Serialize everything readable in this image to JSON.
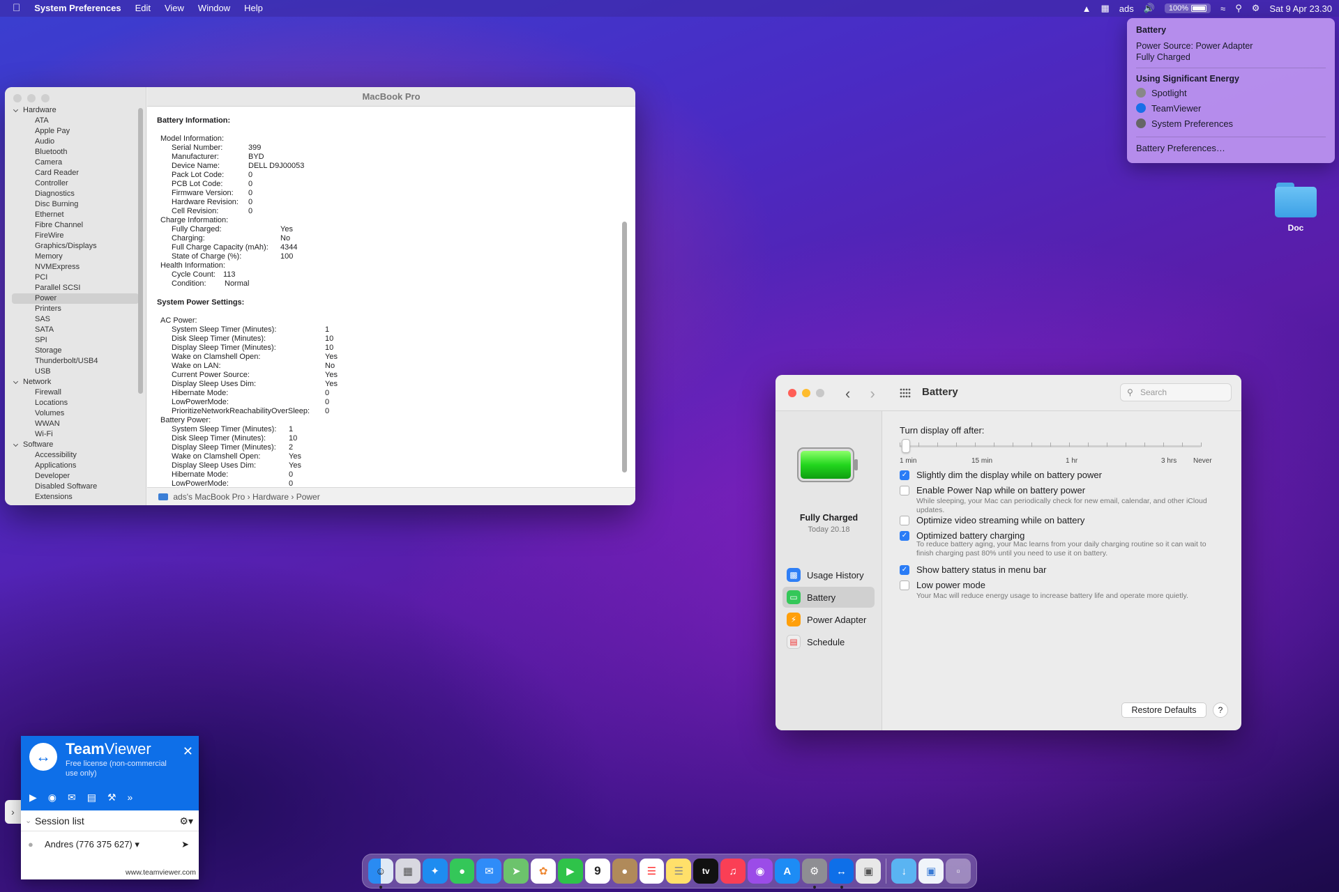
{
  "menubar": {
    "apple": "",
    "app": "System Preferences",
    "items": [
      "Edit",
      "View",
      "Window",
      "Help"
    ],
    "right": {
      "user": "ads",
      "battery": "100%",
      "datetime": "Sat 9 Apr  23.30"
    }
  },
  "battery_menu": {
    "title": "Battery",
    "source": "Power Source: Power Adapter",
    "state": "Fully Charged",
    "energy_header": "Using Significant Energy",
    "apps": [
      "Spotlight",
      "TeamViewer",
      "System Preferences"
    ],
    "prefs_link": "Battery Preferences…"
  },
  "desktop": {
    "folder_label": "Doc"
  },
  "sysinfo": {
    "title": "MacBook Pro",
    "sidebar": [
      {
        "label": "Hardware",
        "type": "section"
      },
      {
        "label": "ATA"
      },
      {
        "label": "Apple Pay"
      },
      {
        "label": "Audio"
      },
      {
        "label": "Bluetooth"
      },
      {
        "label": "Camera"
      },
      {
        "label": "Card Reader"
      },
      {
        "label": "Controller"
      },
      {
        "label": "Diagnostics"
      },
      {
        "label": "Disc Burning"
      },
      {
        "label": "Ethernet"
      },
      {
        "label": "Fibre Channel"
      },
      {
        "label": "FireWire"
      },
      {
        "label": "Graphics/Displays"
      },
      {
        "label": "Memory"
      },
      {
        "label": "NVMExpress"
      },
      {
        "label": "PCI"
      },
      {
        "label": "Parallel SCSI"
      },
      {
        "label": "Power",
        "selected": true
      },
      {
        "label": "Printers"
      },
      {
        "label": "SAS"
      },
      {
        "label": "SATA"
      },
      {
        "label": "SPI"
      },
      {
        "label": "Storage"
      },
      {
        "label": "Thunderbolt/USB4"
      },
      {
        "label": "USB"
      },
      {
        "label": "Network",
        "type": "section"
      },
      {
        "label": "Firewall"
      },
      {
        "label": "Locations"
      },
      {
        "label": "Volumes"
      },
      {
        "label": "WWAN"
      },
      {
        "label": "Wi-Fi"
      },
      {
        "label": "Software",
        "type": "section"
      },
      {
        "label": "Accessibility"
      },
      {
        "label": "Applications"
      },
      {
        "label": "Developer"
      },
      {
        "label": "Disabled Software"
      },
      {
        "label": "Extensions"
      }
    ],
    "battery_info_title": "Battery Information:",
    "system_power_title": "System Power Settings:",
    "battery_info": [
      {
        "k": "Model Information:",
        "v": "",
        "lvl": 1
      },
      {
        "k": "Serial Number:",
        "v": "399",
        "lvl": 2,
        "w": 110
      },
      {
        "k": "Manufacturer:",
        "v": "BYD",
        "lvl": 2,
        "w": 110
      },
      {
        "k": "Device Name:",
        "v": "DELL D9J00053",
        "lvl": 2,
        "w": 110
      },
      {
        "k": "Pack Lot Code:",
        "v": "0",
        "lvl": 2,
        "w": 110
      },
      {
        "k": "PCB Lot Code:",
        "v": "0",
        "lvl": 2,
        "w": 110
      },
      {
        "k": "Firmware Version:",
        "v": "0",
        "lvl": 2,
        "w": 110
      },
      {
        "k": "Hardware Revision:",
        "v": "0",
        "lvl": 2,
        "w": 110
      },
      {
        "k": "Cell Revision:",
        "v": "0",
        "lvl": 2,
        "w": 110
      },
      {
        "k": "Charge Information:",
        "v": "",
        "lvl": 1
      },
      {
        "k": "Fully Charged:",
        "v": "Yes",
        "lvl": 2,
        "w": 156
      },
      {
        "k": "Charging:",
        "v": "No",
        "lvl": 2,
        "w": 156
      },
      {
        "k": "Full Charge Capacity (mAh):",
        "v": "4344",
        "lvl": 2,
        "w": 156
      },
      {
        "k": "State of Charge (%):",
        "v": "100",
        "lvl": 2,
        "w": 156
      },
      {
        "k": "Health Information:",
        "v": "",
        "lvl": 1
      },
      {
        "k": "Cycle Count:",
        "v": "113",
        "lvl": 2,
        "w": 74
      },
      {
        "k": "Condition:",
        "v": "Normal",
        "lvl": 2,
        "w": 76
      }
    ],
    "power_settings": [
      {
        "k": "AC Power:",
        "v": "",
        "lvl": 1
      },
      {
        "k": "System Sleep Timer (Minutes):",
        "v": "1",
        "lvl": 2,
        "w": 220
      },
      {
        "k": "Disk Sleep Timer (Minutes):",
        "v": "10",
        "lvl": 2,
        "w": 220
      },
      {
        "k": "Display Sleep Timer (Minutes):",
        "v": "10",
        "lvl": 2,
        "w": 220
      },
      {
        "k": "Wake on Clamshell Open:",
        "v": "Yes",
        "lvl": 2,
        "w": 220
      },
      {
        "k": "Wake on LAN:",
        "v": "No",
        "lvl": 2,
        "w": 220
      },
      {
        "k": "Current Power Source:",
        "v": "Yes",
        "lvl": 2,
        "w": 220
      },
      {
        "k": "Display Sleep Uses Dim:",
        "v": "Yes",
        "lvl": 2,
        "w": 220
      },
      {
        "k": "Hibernate Mode:",
        "v": "0",
        "lvl": 2,
        "w": 220
      },
      {
        "k": "LowPowerMode:",
        "v": "0",
        "lvl": 2,
        "w": 220
      },
      {
        "k": "PrioritizeNetworkReachabilityOverSleep:",
        "v": "0",
        "lvl": 2,
        "w": 220
      },
      {
        "k": "Battery Power:",
        "v": "",
        "lvl": 1
      },
      {
        "k": "System Sleep Timer (Minutes):",
        "v": "1",
        "lvl": 2,
        "w": 168
      },
      {
        "k": "Disk Sleep Timer (Minutes):",
        "v": "10",
        "lvl": 2,
        "w": 168
      },
      {
        "k": "Display Sleep Timer (Minutes):",
        "v": "2",
        "lvl": 2,
        "w": 168
      },
      {
        "k": "Wake on Clamshell Open:",
        "v": "Yes",
        "lvl": 2,
        "w": 168
      },
      {
        "k": "Display Sleep Uses Dim:",
        "v": "Yes",
        "lvl": 2,
        "w": 168
      },
      {
        "k": "Hibernate Mode:",
        "v": "0",
        "lvl": 2,
        "w": 168
      },
      {
        "k": "LowPowerMode:",
        "v": "0",
        "lvl": 2,
        "w": 168
      }
    ],
    "path": "ads's MacBook Pro  ›  Hardware  ›  Power"
  },
  "prefs": {
    "title": "Battery",
    "search_placeholder": "Search",
    "status": "Fully Charged",
    "status_time": "Today 20.18",
    "nav": [
      "Usage History",
      "Battery",
      "Power Adapter",
      "Schedule"
    ],
    "slider_label": "Turn display off after:",
    "slider_value_fraction": 0.02,
    "tick_labels": [
      "1 min",
      "15 min",
      "1 hr",
      "3 hrs",
      "Never"
    ],
    "options": [
      {
        "label": "Slightly dim the display while on battery power",
        "checked": true,
        "desc": ""
      },
      {
        "label": "Enable Power Nap while on battery power",
        "checked": false,
        "desc": "While sleeping, your Mac can periodically check for new email, calendar, and other iCloud updates."
      },
      {
        "label": "Optimize video streaming while on battery",
        "checked": false,
        "desc": ""
      },
      {
        "label": "Optimized battery charging",
        "checked": true,
        "desc": "To reduce battery aging, your Mac learns from your daily charging routine so it can wait to finish charging past 80% until you need to use it on battery."
      },
      {
        "label": "Show battery status in menu bar",
        "checked": true,
        "desc": ""
      },
      {
        "label": "Low power mode",
        "checked": false,
        "desc": "Your Mac will reduce energy usage to increase battery life and operate more quietly."
      }
    ],
    "restore": "Restore Defaults",
    "help": "?"
  },
  "teamviewer": {
    "brand_bold": "Team",
    "brand_rest": "Viewer",
    "license": "Free license (non-commercial use only)",
    "session_list": "Session list",
    "user": "Andres (776 375 627)",
    "url": "www.teamviewer.com"
  },
  "dock": {
    "apps": [
      "finder",
      "launchpad",
      "safari",
      "messages",
      "mail",
      "maps",
      "photos",
      "facetime",
      "calendar",
      "contacts",
      "reminders",
      "notes",
      "tv",
      "music",
      "podcasts",
      "app-store",
      "system-preferences",
      "teamviewer",
      "preview"
    ],
    "calendar_day": "9",
    "tv_label": "tv"
  }
}
